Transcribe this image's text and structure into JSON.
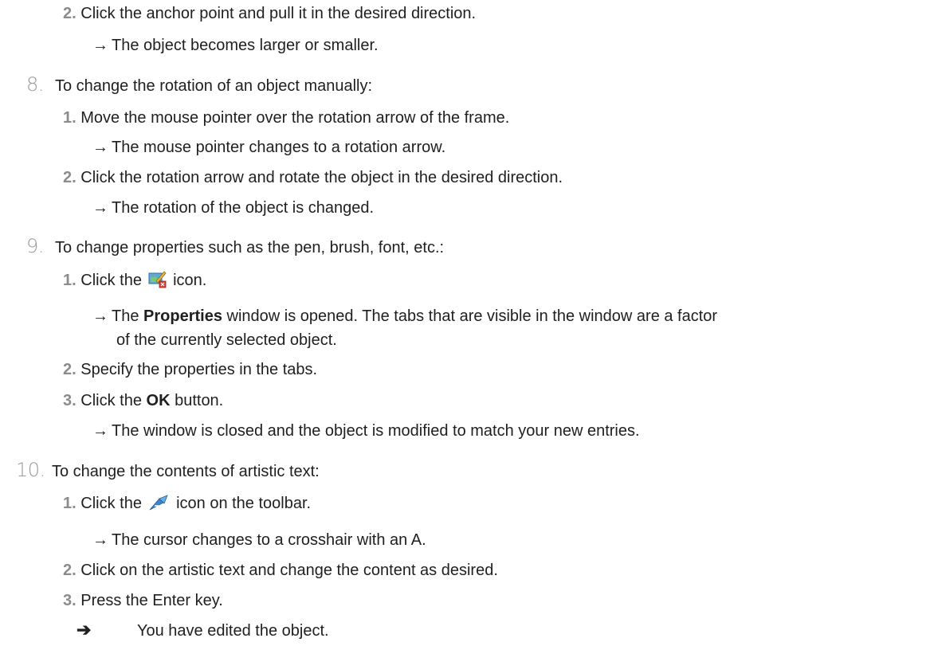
{
  "arrow_glyph": "→",
  "final_arrow_glyph": "➔",
  "block_a": {
    "sub2_num": "2.",
    "sub2_text": "Click the anchor point and pull it in the desired direction.",
    "sub2_result": "The object becomes larger or smaller."
  },
  "step8": {
    "num": "8.",
    "text": "To change the rotation of an object manually:",
    "sub1_num": "1.",
    "sub1_text": "Move the mouse pointer over the rotation arrow of the frame.",
    "sub1_result": "The mouse pointer changes to a rotation arrow.",
    "sub2_num": "2.",
    "sub2_text": "Click the rotation arrow and rotate the object in the desired direction.",
    "sub2_result": "The rotation of the object is changed."
  },
  "step9": {
    "num": "9.",
    "text": "To change properties such as the pen, brush, font, etc.:",
    "sub1_num": "1.",
    "sub1_before": "Click the",
    "sub1_icon": "properties-icon",
    "sub1_after": "icon.",
    "sub1_result_a": "The",
    "sub1_result_bold": "Properties",
    "sub1_result_b": "window is opened. The tabs that are visible in the window are a factor",
    "sub1_result_wrap": "of the currently selected object.",
    "sub2_num": "2.",
    "sub2_text": "Specify the properties in the tabs.",
    "sub3_num": "3.",
    "sub3_before": "Click the",
    "sub3_bold": "OK",
    "sub3_after": "button.",
    "sub3_result": "The window is closed and the object is modified to match your new entries."
  },
  "step10": {
    "num": "10.",
    "text": "To change the contents of artistic text:",
    "sub1_num": "1.",
    "sub1_before": "Click the",
    "sub1_icon": "artistic-text-icon",
    "sub1_after": "icon on the toolbar.",
    "sub1_result": "The cursor changes to a crosshair with an A.",
    "sub2_num": "2.",
    "sub2_text": "Click on the artistic text and change the content as desired.",
    "sub3_num": "3.",
    "sub3_text": "Press the Enter key.",
    "final_text": "You have edited the object."
  },
  "colors": {
    "text": "#1f1f1f",
    "step_number": "#9a9a9a",
    "substep_number": "#8c8c8c"
  }
}
